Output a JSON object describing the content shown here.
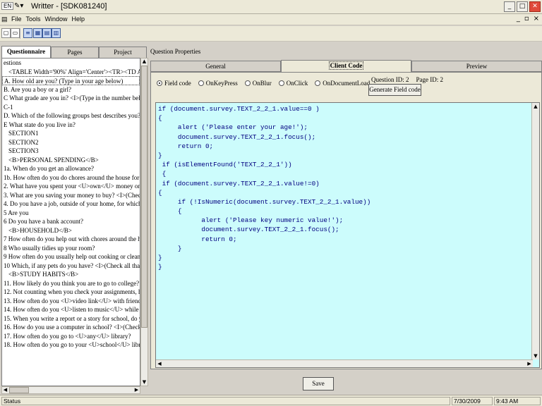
{
  "titlebar": {
    "lang": "EN",
    "title": "Writter - [SDK081240]"
  },
  "menubar": {
    "items": [
      "File",
      "Tools",
      "Window",
      "Help"
    ]
  },
  "left_tabs": [
    "Questionnaire",
    "Pages",
    "Project"
  ],
  "questions": [
    "estions",
    "<TABLE Width='90%' Align='Center'><TR><TD Align='",
    "A. How old are you? (Type in your age below)",
    "B. Are you a boy or a girl?",
    "C What grade are you in? <I>(Type in the number below",
    "C-1",
    "D. Which of the following groups best describes you?",
    "E What state do you live in?",
    "SECTION1",
    "SECTION2",
    "SECTION3",
    "<B>PERSONAL SPENDING</B>",
    "1a. When do you get an allowance?",
    "1b. How often do you do chores around the house for w",
    "2. What have you spent your <U>own</U> money on in",
    "3. What are you saving your money to buy?  <I>(Check",
    "4. Do you have a job, outside of your home, for which yo",
    "5 Are you",
    "6 Do you have a bank account?",
    "<B>HOUSEHOLD</B>",
    "7 How often do you help out with chores around the hou",
    "8 Who usually tidies up your room?",
    "9 How often do you usually help out cooking or cleaning",
    "10 Which, if any pets do you have?  <I>(Check all  that a",
    "<B>STUDY HABITS</B>",
    "11. How likely do you think you are to go to college?",
    "12. Not counting when you check your assignments, how",
    "13. How often do you <U>video link</U> with friends w",
    "14. How often do you <U>listen to music</U> while doi",
    "15. When you write a report or a story for school, do yo",
    "16. How do you use a computer in school? <I>(Check all",
    "17. How often do you go to <U>any</U> library?",
    "18. How often do you go to your <U>school</U> library"
  ],
  "question_properties_label": "Question Properties",
  "right_tabs": [
    "General",
    "Client Code",
    "Preview"
  ],
  "radios": [
    "Field code",
    "OnKeyPress",
    "OnBlur",
    "OnClick",
    "OnDocumentLoad"
  ],
  "question_id": "Question ID: 2",
  "page_id": "Page ID: 2",
  "generate_button": "Generate Field code",
  "code_lines": [
    "if (document.survey.TEXT_2_2_1.value==0 )",
    "{",
    "     alert ('Please enter your age!');",
    "     document.survey.TEXT_2_2_1.focus();",
    "     return 0;",
    "}",
    " if (isElementFound('TEXT_2_2_1'))",
    " {",
    " if (document.survey.TEXT_2_2_1.value!=0)",
    "{",
    "     if (!IsNumeric(document.survey.TEXT_2_2_1.value))",
    "     {",
    "           alert ('Please key numeric value!');",
    "           document.survey.TEXT_2_2_1.focus();",
    "           return 0;",
    "     }",
    "}",
    "}"
  ],
  "save_button": "Save",
  "status": {
    "text": "Status",
    "date": "7/30/2009",
    "time": "9:43 AM"
  },
  "icons": [
    "minimize-icon",
    "maximize-icon",
    "close-icon",
    "new-icon",
    "open-icon"
  ]
}
